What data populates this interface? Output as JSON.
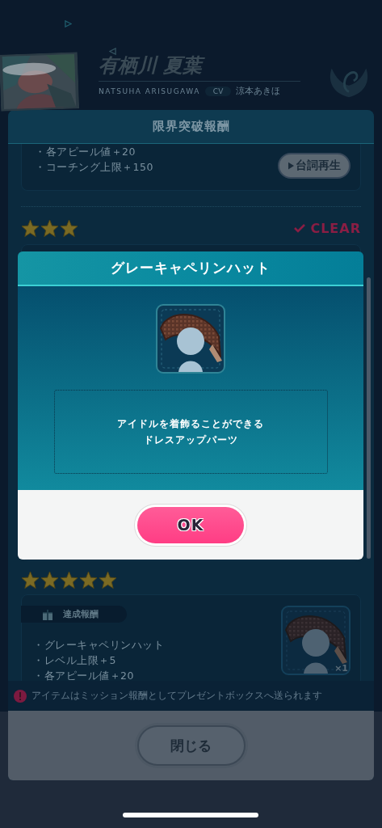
{
  "character": {
    "name": "有栖川 夏葉",
    "romaji": "NATSUHA ARISUGAWA",
    "cv_label": "CV",
    "cv_name": "涼本あきほ"
  },
  "panel": {
    "title": "限界突破報酬",
    "previous_reward": {
      "lines": [
        "・各アピール値＋20",
        "・コーチング上限＋150"
      ],
      "voice_button": "台詞再生"
    },
    "tiers": [
      {
        "stars": 3,
        "cleared": true,
        "status": "CLEAR"
      },
      {
        "stars": 5,
        "reward_tag": "達成報酬",
        "lines": [
          "・グレーキャペリンハット",
          "・レベル上限＋5",
          "・各アピール値＋20"
        ],
        "item_count": "×1"
      }
    ],
    "notice": "アイテムはミッション報酬としてプレゼントボックスへ送られます",
    "close_button": "閉じる"
  },
  "dialog": {
    "title": "グレーキャペリンハット",
    "description": [
      "アイドルを着飾ることができる",
      "ドレスアップパーツ"
    ],
    "ok_button": "OK"
  }
}
